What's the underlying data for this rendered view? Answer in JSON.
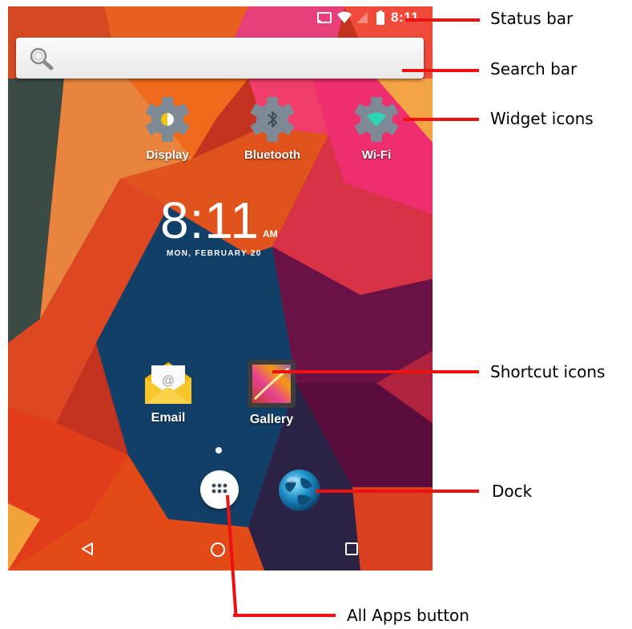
{
  "status_bar": {
    "time": "8:11",
    "icons": [
      "cast-icon",
      "wifi-icon",
      "no-signal-icon",
      "battery-icon"
    ]
  },
  "search_bar": {
    "icon": "search-icon"
  },
  "widgets": [
    {
      "id": "display",
      "label": "Display",
      "icon": "display-gear-icon"
    },
    {
      "id": "bluetooth",
      "label": "Bluetooth",
      "icon": "bluetooth-gear-icon"
    },
    {
      "id": "wifi",
      "label": "Wi-Fi",
      "icon": "wifi-gear-icon"
    }
  ],
  "clock": {
    "time": "8:11",
    "ampm": "AM",
    "date": "MON, FEBRUARY 20"
  },
  "shortcuts": [
    {
      "id": "email",
      "label": "Email",
      "icon": "email-icon"
    },
    {
      "id": "gallery",
      "label": "Gallery",
      "icon": "gallery-icon"
    }
  ],
  "dock": {
    "items": [
      "all-apps-icon",
      "browser-globe-icon"
    ]
  },
  "navbar": {
    "icons": [
      "back-icon",
      "home-icon",
      "recents-icon"
    ]
  },
  "callouts": {
    "status_bar": "Status bar",
    "search_bar": "Search bar",
    "widget_icons": "Widget icons",
    "shortcut_icons": "Shortcut icons",
    "dock": "Dock",
    "all_apps": "All Apps button"
  },
  "colors": {
    "callout_line": "#ee1111",
    "widget_gear": "#7d8a96",
    "display_accent": "#f1c40f",
    "wifi_accent": "#2ed4b5"
  }
}
